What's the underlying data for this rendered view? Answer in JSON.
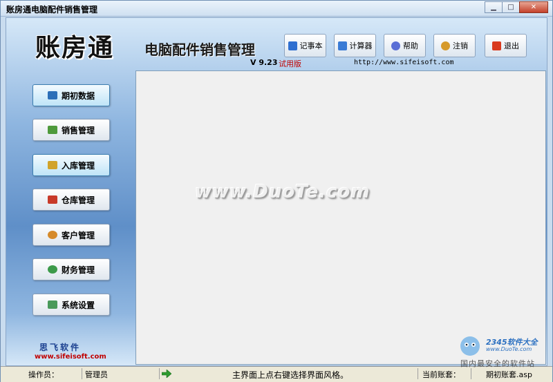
{
  "window": {
    "title": "账房通电脑配件销售管理",
    "controls": [
      "minimize",
      "maximize",
      "close"
    ]
  },
  "header": {
    "logo": "账房通",
    "subtitle": "电脑配件销售管理",
    "version": "V 9.23",
    "edition": "试用版",
    "url": "http://www.sifeisoft.com"
  },
  "toolbar": [
    {
      "label": "记事本",
      "icon": "notepad-icon",
      "color": "#2f6fd0"
    },
    {
      "label": "计算器",
      "icon": "calculator-icon",
      "color": "#3a7bd5"
    },
    {
      "label": "帮助",
      "icon": "help-icon",
      "color": "#5a6fd6"
    },
    {
      "label": "注销",
      "icon": "users-icon",
      "color": "#d69a2a"
    },
    {
      "label": "退出",
      "icon": "power-icon",
      "color": "#d93a1e"
    }
  ],
  "sidebar": {
    "items": [
      {
        "label": "期初数据",
        "icon": "book-icon",
        "color": "#2d6fb8",
        "active": true
      },
      {
        "label": "销售管理",
        "icon": "sales-icon",
        "color": "#4e9a3c",
        "active": false
      },
      {
        "label": "入库管理",
        "icon": "package-icon",
        "color": "#d1a32a",
        "active": true
      },
      {
        "label": "仓库管理",
        "icon": "warehouse-icon",
        "color": "#c83a2a",
        "active": false
      },
      {
        "label": "客户管理",
        "icon": "customers-icon",
        "color": "#d68a2a",
        "active": false
      },
      {
        "label": "财务管理",
        "icon": "finance-icon",
        "color": "#3c9a4a",
        "active": false
      },
      {
        "label": "系统设置",
        "icon": "settings-icon",
        "color": "#4a9a5a",
        "active": false
      }
    ],
    "brand": "思飞软件",
    "brand_url": "www.sifeisoft.com"
  },
  "watermark": "www.DuoTe.com",
  "statusbar": {
    "operator_label": "操作员：",
    "operator_value": "管理员",
    "hint": "主界面上点右键选择界面风格。",
    "account_label": "当前账套：",
    "account_value": "期初账套.asp"
  },
  "badge": {
    "logo": "2345软件大全",
    "url": "www.DuoTe.com",
    "caption": "国内最安全的软件站"
  }
}
